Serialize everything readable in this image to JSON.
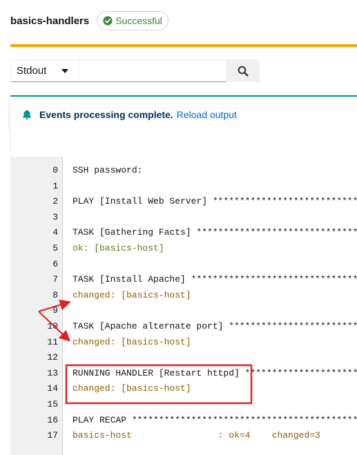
{
  "header": {
    "job_name": "basics-handlers",
    "status_label": "Successful",
    "status_color": "#3e8635"
  },
  "toolbar": {
    "stream_selected": "Stdout",
    "search_value": "",
    "search_icon": "search-icon"
  },
  "alert": {
    "title": "Events processing complete.",
    "link": "Reload output",
    "icon": "bell-icon",
    "accent": "#009596"
  },
  "output": {
    "lines": [
      {
        "n": "0",
        "text": "SSH password:",
        "kind": "plain"
      },
      {
        "n": "1",
        "text": "",
        "kind": "plain"
      },
      {
        "n": "2",
        "text": "PLAY [Install Web Server] ****************************************",
        "kind": "plain"
      },
      {
        "n": "3",
        "text": "",
        "kind": "plain"
      },
      {
        "n": "4",
        "text": "TASK [Gathering Facts] *******************************************",
        "kind": "plain"
      },
      {
        "n": "5",
        "text": "ok: [basics-host]",
        "kind": "ok"
      },
      {
        "n": "6",
        "text": "",
        "kind": "plain"
      },
      {
        "n": "7",
        "text": "TASK [Install Apache] ********************************************",
        "kind": "plain"
      },
      {
        "n": "8",
        "text": "changed: [basics-host]",
        "kind": "changed"
      },
      {
        "n": "9",
        "text": "",
        "kind": "plain"
      },
      {
        "n": "10",
        "text": "TASK [Apache alternate port] *************************************",
        "kind": "plain"
      },
      {
        "n": "11",
        "text": "changed: [basics-host]",
        "kind": "changed"
      },
      {
        "n": "12",
        "text": "",
        "kind": "plain"
      },
      {
        "n": "13",
        "text": "RUNNING HANDLER [Restart httpd] **********************************",
        "kind": "plain"
      },
      {
        "n": "14",
        "text": "changed: [basics-host]",
        "kind": "changed"
      },
      {
        "n": "15",
        "text": "",
        "kind": "plain"
      },
      {
        "n": "16",
        "text": "PLAY RECAP *******************************************************",
        "kind": "plain"
      },
      {
        "n": "17",
        "text": "basics-host                : ok=4    changed=3",
        "kind": "changed"
      }
    ]
  },
  "colors": {
    "gold_divider": "#f0ab00",
    "annotation_red": "#e02020",
    "ok_text": "#5f7a1e",
    "changed_text": "#8f5f00"
  }
}
